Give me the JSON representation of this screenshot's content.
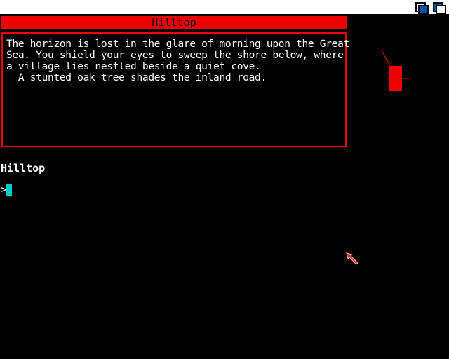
{
  "screen": {
    "depth_gadget_icon": "depth-arrange-icon",
    "colors": {
      "background": "#000000",
      "accent": "#ee0000",
      "text": "#ffffff",
      "cursor": "#00cccc",
      "gadget_blue": "#0055aa"
    }
  },
  "room": {
    "title": "Hilltop",
    "description": "The horizon is lost in the glare of morning upon the Great\nSea. You shield your eyes to sweep the shore below, where\na village lies nestled beside a quiet cove.\n  A stunted oak tree shades the inland road."
  },
  "status": {
    "location": "Hilltop"
  },
  "prompt": {
    "symbol": ">",
    "value": ""
  },
  "pointer": {
    "icon": "mouse-pointer-arrow-icon"
  }
}
